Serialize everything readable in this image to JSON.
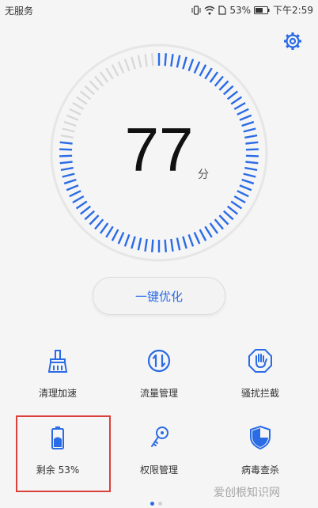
{
  "status_bar": {
    "carrier": "无服务",
    "battery": "53%",
    "time": "下午2:59"
  },
  "score": {
    "value": "77",
    "unit": "分",
    "level": 0.77
  },
  "optimize_button": {
    "label": "一键优化"
  },
  "tools": [
    {
      "label": "清理加速",
      "icon": "broom-icon"
    },
    {
      "label": "流量管理",
      "icon": "data-traffic-icon"
    },
    {
      "label": "骚扰拦截",
      "icon": "block-hand-icon"
    },
    {
      "label": "剩余 53%",
      "icon": "battery-icon"
    },
    {
      "label": "权限管理",
      "icon": "key-icon"
    },
    {
      "label": "病毒查杀",
      "icon": "shield-icon"
    }
  ],
  "watermark": "爱创根知识网",
  "colors": {
    "accent": "#2a6be6",
    "highlight": "#d9413b"
  }
}
